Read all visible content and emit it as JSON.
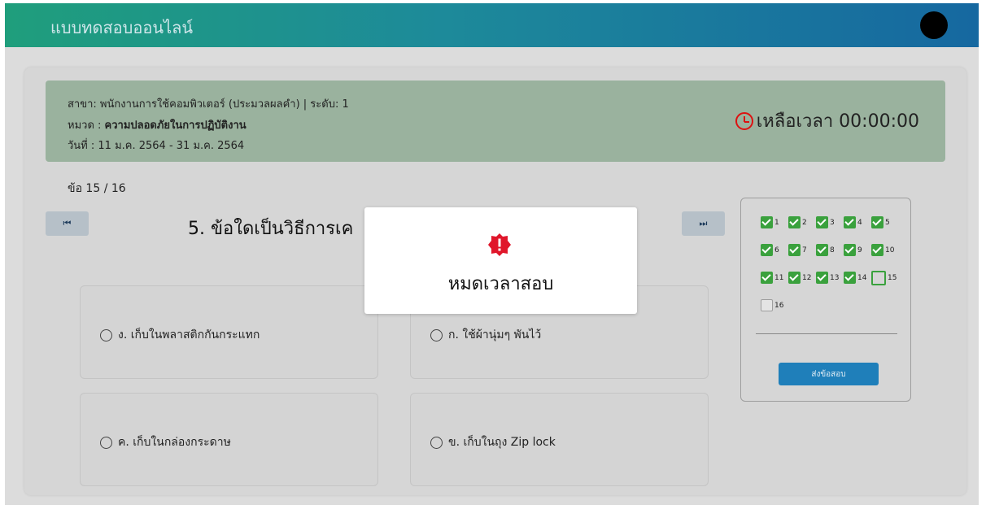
{
  "header": {
    "title": "แบบทดสอบออนไลน์",
    "avatar_icon": "user-avatar"
  },
  "exam_info": {
    "line1": "สาขา: พนักงานการใช้คอมพิวเตอร์ (ประมวลผลคำ) | ระดับ: 1",
    "category_label": "หมวด : ",
    "category_value": "ความปลอดภัยในการปฏิบัติงาน",
    "date_line": "วันที่ : 11 ม.ค. 2564 - 31 ม.ค. 2564"
  },
  "timer": {
    "label": "เหลือเวลา 00:00:00",
    "icon": "clock-icon",
    "color": "#dd1111"
  },
  "question": {
    "counter": "ข้อ 15 / 16",
    "text": "5. ข้อใดเป็นวิธีการเค",
    "prev_icon": "⏮",
    "next_icon": "⏭"
  },
  "options": [
    {
      "label": "ง. เก็บในพลาสติกกันกระแทก"
    },
    {
      "label": "ก. ใช้ผ้านุ่มๆ พันไว้"
    },
    {
      "label": "ค. เก็บในกล่องกระดาษ"
    },
    {
      "label": "ข. เก็บในถุง Zip lock"
    }
  ],
  "question_nav": {
    "items": [
      {
        "num": "1",
        "state": "answered"
      },
      {
        "num": "2",
        "state": "answered"
      },
      {
        "num": "3",
        "state": "answered"
      },
      {
        "num": "4",
        "state": "answered"
      },
      {
        "num": "5",
        "state": "answered"
      },
      {
        "num": "6",
        "state": "answered"
      },
      {
        "num": "7",
        "state": "answered"
      },
      {
        "num": "8",
        "state": "answered"
      },
      {
        "num": "9",
        "state": "answered"
      },
      {
        "num": "10",
        "state": "answered"
      },
      {
        "num": "11",
        "state": "answered"
      },
      {
        "num": "12",
        "state": "answered"
      },
      {
        "num": "13",
        "state": "answered"
      },
      {
        "num": "14",
        "state": "answered"
      },
      {
        "num": "15",
        "state": "current"
      },
      {
        "num": "16",
        "state": "unanswered"
      }
    ],
    "submit_label": "ส่งข้อสอบ"
  },
  "modal": {
    "message": "หมดเวลาสอบ",
    "icon": "alert-badge-icon",
    "icon_color": "#e0162b"
  },
  "colors": {
    "answered": "#3aa13d",
    "submit": "#1f7fba",
    "info_bg": "#9ab29e"
  }
}
